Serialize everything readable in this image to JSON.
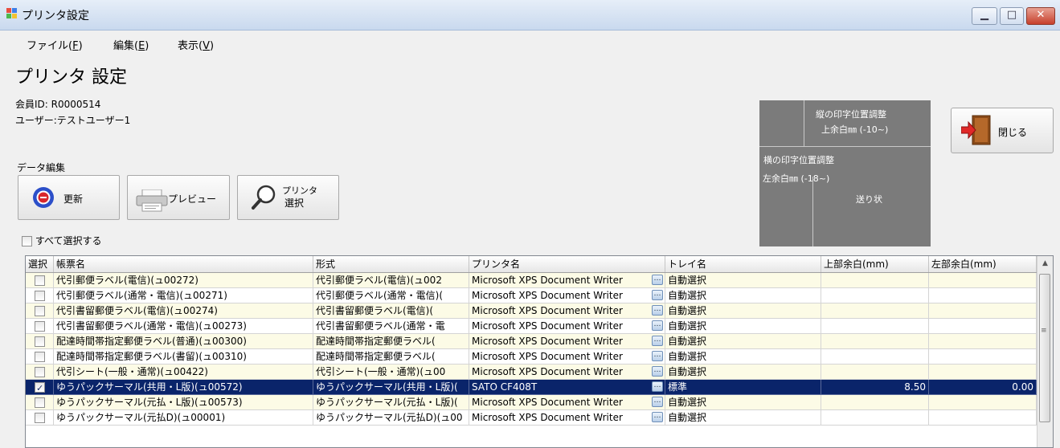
{
  "window": {
    "title": "プリンタ設定"
  },
  "menu": [
    {
      "label": "ファイル(",
      "key": "F",
      "suffix": ")"
    },
    {
      "label": "編集(",
      "key": "E",
      "suffix": ")"
    },
    {
      "label": "表示(",
      "key": "V",
      "suffix": ")"
    }
  ],
  "page": {
    "title": "プリンタ 設定",
    "member_id": "会員ID: R0000514",
    "user": "ユーザー:テストユーザー1"
  },
  "toolbar": {
    "group_label": "データ編集",
    "update_label": "更新",
    "preview_label": "プレビュー",
    "printer_select_line1": "プリンタ",
    "printer_select_line2": "選択"
  },
  "position_panel": {
    "vertical_title": "縦の印字位置調整",
    "vertical_sub": "上余白㎜ (-10~)",
    "horizontal_title": "横の印字位置調整",
    "horizontal_sub": "左余白㎜ (-18~)",
    "label": "送り状"
  },
  "close_label": "閉じる",
  "select_all_label": "すべて選択する",
  "grid": {
    "columns": [
      "選択",
      "帳票名",
      "形式",
      "プリンタ名",
      "トレイ名",
      "上部余白(mm)",
      "左部余白(mm)"
    ],
    "rows": [
      {
        "checked": false,
        "name": "代引郵便ラベル(電信)(ュ00272)",
        "format": "代引郵便ラベル(電信)(ュ002",
        "printer": "Microsoft XPS Document Writer",
        "tray": "自動選択",
        "top": "",
        "left": ""
      },
      {
        "checked": false,
        "name": "代引郵便ラベル(通常・電信)(ュ00271)",
        "format": "代引郵便ラベル(通常・電信)(",
        "printer": "Microsoft XPS Document Writer",
        "tray": "自動選択",
        "top": "",
        "left": ""
      },
      {
        "checked": false,
        "name": "代引書留郵便ラベル(電信)(ュ00274)",
        "format": "代引書留郵便ラベル(電信)(",
        "printer": "Microsoft XPS Document Writer",
        "tray": "自動選択",
        "top": "",
        "left": ""
      },
      {
        "checked": false,
        "name": "代引書留郵便ラベル(通常・電信)(ュ00273)",
        "format": "代引書留郵便ラベル(通常・電",
        "printer": "Microsoft XPS Document Writer",
        "tray": "自動選択",
        "top": "",
        "left": ""
      },
      {
        "checked": false,
        "name": "配達時間帯指定郵便ラベル(普通)(ュ00300)",
        "format": "配達時間帯指定郵便ラベル(",
        "printer": "Microsoft XPS Document Writer",
        "tray": "自動選択",
        "top": "",
        "left": ""
      },
      {
        "checked": false,
        "name": "配達時間帯指定郵便ラベル(書留)(ュ00310)",
        "format": "配達時間帯指定郵便ラベル(",
        "printer": "Microsoft XPS Document Writer",
        "tray": "自動選択",
        "top": "",
        "left": ""
      },
      {
        "checked": false,
        "name": "代引シート(一般・通常)(ュ00422)",
        "format": "代引シート(一般・通常)(ュ00",
        "printer": "Microsoft XPS Document Writer",
        "tray": "自動選択",
        "top": "",
        "left": ""
      },
      {
        "checked": true,
        "name": "ゆうパックサーマル(共用・L版)(ュ00572)",
        "format": "ゆうパックサーマル(共用・L版)(",
        "printer": "SATO CF408T",
        "tray": "標準",
        "top": "8.50",
        "left": "0.00"
      },
      {
        "checked": false,
        "name": "ゆうパックサーマル(元払・L版)(ュ00573)",
        "format": "ゆうパックサーマル(元払・L版)(",
        "printer": "Microsoft XPS Document Writer",
        "tray": "自動選択",
        "top": "",
        "left": ""
      },
      {
        "checked": false,
        "name": "ゆうパックサーマル(元払D)(ュ00001)",
        "format": "ゆうパックサーマル(元払D)(ュ00",
        "printer": "Microsoft XPS Document Writer",
        "tray": "自動選択",
        "top": "",
        "left": ""
      }
    ]
  }
}
